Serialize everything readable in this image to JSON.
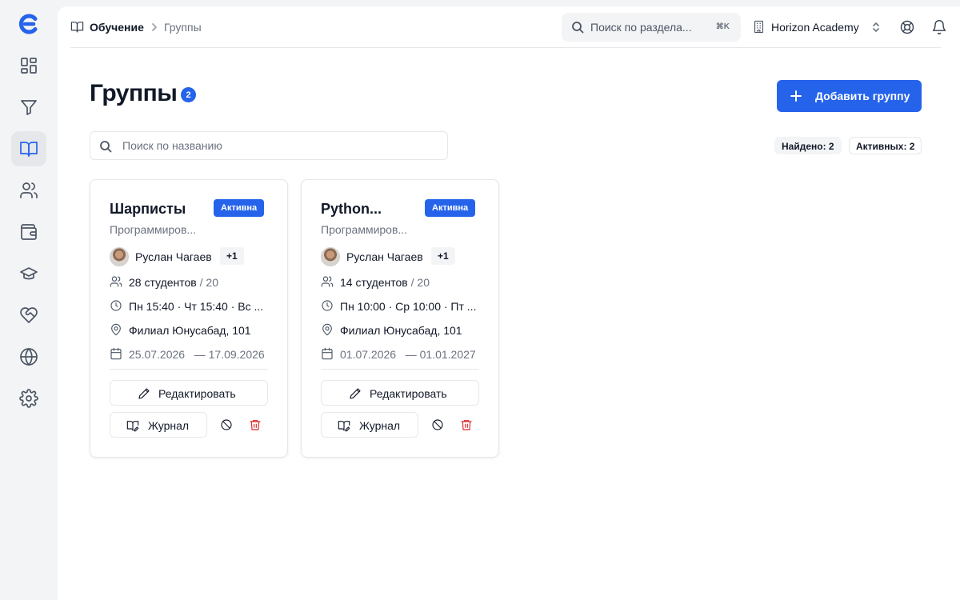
{
  "breadcrumb": {
    "section": "Обучение",
    "current": "Группы"
  },
  "header": {
    "search_placeholder": "Поиск по раздела...",
    "search_shortcut": "⌘K",
    "organization": "Horizon Academy"
  },
  "sidebar": {
    "items": [
      {
        "name": "dashboard",
        "icon": "grid-icon"
      },
      {
        "name": "funnel",
        "icon": "filter-icon"
      },
      {
        "name": "education",
        "icon": "book-icon",
        "active": true
      },
      {
        "name": "users",
        "icon": "users-icon"
      },
      {
        "name": "finance",
        "icon": "wallet-icon"
      },
      {
        "name": "graduation",
        "icon": "graduation-cap-icon"
      },
      {
        "name": "care",
        "icon": "heart-handshake-icon"
      },
      {
        "name": "web",
        "icon": "globe-icon"
      },
      {
        "name": "settings",
        "icon": "gear-icon"
      }
    ]
  },
  "page": {
    "title": "Группы",
    "count": "2",
    "add_button": "Добавить группу",
    "search_placeholder": "Поиск по названию",
    "found_label": "Найдено: 2",
    "active_label": "Активных: 2"
  },
  "groups": [
    {
      "title": "Шарписты",
      "status": "Активна",
      "subtitle": "Программиров...",
      "teacher": "Руслан Чагаев",
      "extra_teachers": "+1",
      "students": "28 студентов",
      "capacity": "/ 20",
      "schedule": "Пн 15:40 · Чт 15:40 · Вс ...",
      "branch": "Филиал Юнусабад, 101",
      "dates": "25.07.2026   — 17.09.2026",
      "edit_label": "Редактировать",
      "journal_label": "Журнал"
    },
    {
      "title": "Python...",
      "status": "Активна",
      "subtitle": "Программиров...",
      "teacher": "Руслан Чагаев",
      "extra_teachers": "+1",
      "students": "14 студентов",
      "capacity": "/ 20",
      "schedule": "Пн 10:00 · Ср 10:00 · Пт ...",
      "branch": "Филиал Юнусабад, 101",
      "dates": "01.07.2026   — 01.01.2027",
      "edit_label": "Редактировать",
      "journal_label": "Журнал"
    }
  ],
  "colors": {
    "accent": "#2563eb",
    "danger": "#dc2626",
    "muted": "#6b7280"
  }
}
